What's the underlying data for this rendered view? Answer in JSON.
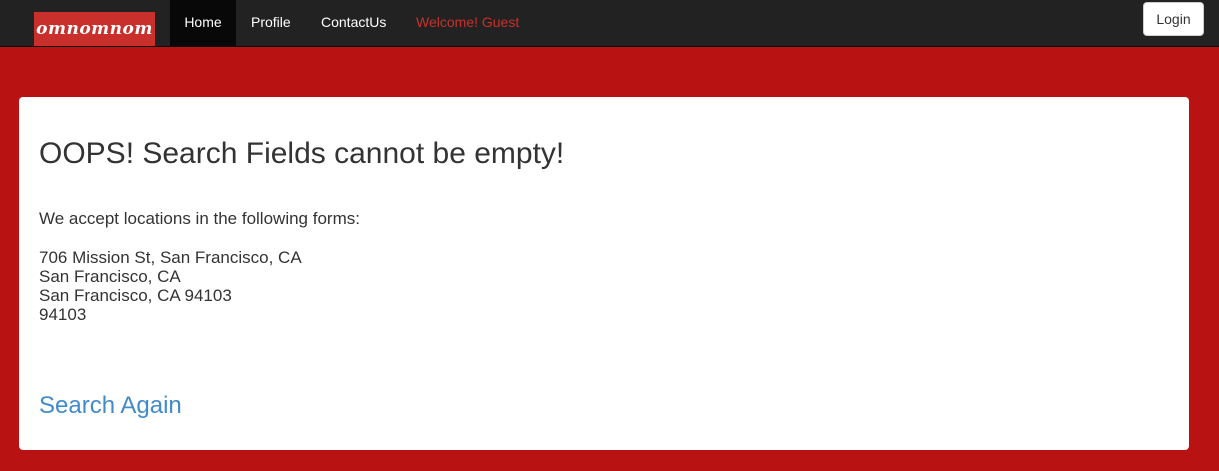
{
  "navbar": {
    "brand": "omnomnom",
    "items": [
      {
        "label": "Home",
        "active": true
      },
      {
        "label": "Profile",
        "active": false
      },
      {
        "label": "ContactUs",
        "active": false
      }
    ],
    "welcome": "Welcome! Guest",
    "login_label": "Login"
  },
  "main": {
    "title": "OOPS! Search Fields cannot be empty!",
    "intro": "We accept locations in the following forms:",
    "examples": [
      "706 Mission St, San Francisco, CA",
      "San Francisco, CA",
      "San Francisco, CA 94103",
      "94103"
    ],
    "search_again_label": "Search Again"
  },
  "colors": {
    "page_background": "#b81212",
    "navbar_background": "#222222",
    "brand_background": "#c9302c",
    "welcome_text": "#c9302c",
    "link": "#428bca"
  }
}
